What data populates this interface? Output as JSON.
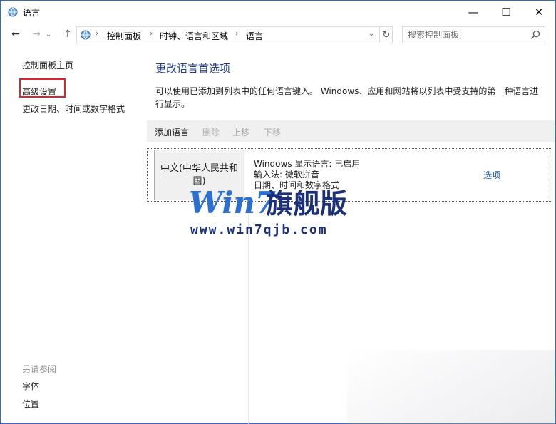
{
  "window": {
    "title": "语言"
  },
  "titlebar_buttons": {
    "minimize": "—",
    "maximize": "☐",
    "close": "✕"
  },
  "nav": {
    "back": "←",
    "forward": "→",
    "history": "⌄",
    "up": "↑",
    "refresh": "↻",
    "dropdown": "⌄"
  },
  "breadcrumb": [
    "控制面板",
    "时钟、语言和区域",
    "语言"
  ],
  "search": {
    "placeholder": "搜索控制面板"
  },
  "left": {
    "home": "控制面板主页",
    "advanced": "高级设置",
    "datetime": "更改日期、时间或数字格式",
    "see_also": "另请参阅",
    "fonts": "字体",
    "location": "位置"
  },
  "main": {
    "title": "更改语言首选项",
    "description": "可以使用已添加到列表中的任何语言键入。 Windows、应用和网站将以列表中受支持的第一种语言进行显示。",
    "toolbar": {
      "add": "添加语言",
      "remove": "删除",
      "up": "上移",
      "down": "下移"
    },
    "language": {
      "name": "中文(中华人民共和国)",
      "display": "Windows 显示语言: 已启用",
      "ime": "输入法: 微软拼音",
      "format": "日期、时间和数字格式",
      "options": "选项"
    }
  },
  "watermark": {
    "logo": "Win7旗舰版",
    "url": "www.win7qjb.com"
  },
  "colors": {
    "accent": "#1e3d8f",
    "link": "#1e5bc6",
    "highlight_box": "#d8262e",
    "watermark": "#1b2f7a"
  }
}
